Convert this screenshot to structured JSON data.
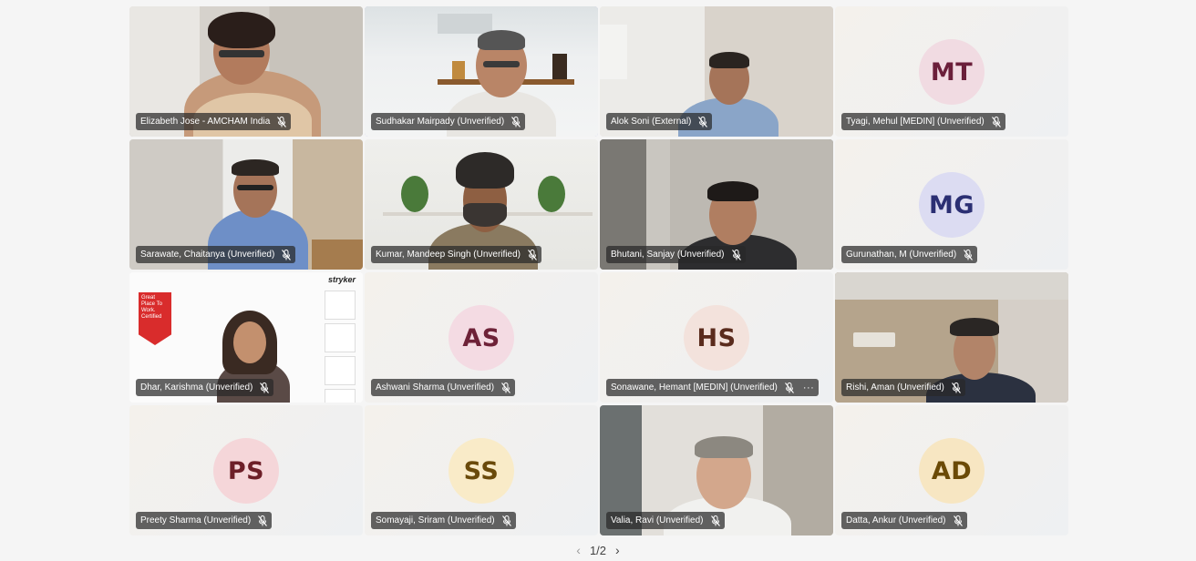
{
  "meeting": {
    "tiles": [
      {
        "name": "Elizabeth Jose - AMCHAM India",
        "type": "video",
        "scene": "office-woman",
        "more": false
      },
      {
        "name": "Sudhakar Mairpady (Unverified)",
        "type": "video",
        "scene": "office-man-shelf",
        "active": true,
        "more": false
      },
      {
        "name": "Alok Soni (External)",
        "type": "video",
        "scene": "room-man",
        "more": false
      },
      {
        "name": "Tyagi, Mehul [MEDIN] (Unverified)",
        "type": "avatar",
        "initials": "MT",
        "avatar_bg": "#f1dbe2",
        "avatar_fg": "#6b1f3a",
        "more": false
      },
      {
        "name": "Sarawate, Chaitanya (Unverified)",
        "type": "video",
        "scene": "office-man-blue",
        "more": false
      },
      {
        "name": "Kumar, Mandeep Singh (Unverified)",
        "type": "video",
        "scene": "turban-man",
        "more": false
      },
      {
        "name": "Bhutani, Sanjay (Unverified)",
        "type": "video",
        "scene": "room-man-dark",
        "more": false
      },
      {
        "name": "Gurunathan, M (Unverified)",
        "type": "avatar",
        "initials": "MG",
        "avatar_bg": "#dcdcf2",
        "avatar_fg": "#2b2f73",
        "more": false
      },
      {
        "name": "Dhar, Karishma (Unverified)",
        "type": "video",
        "scene": "stryker-woman",
        "logo_text": "stryker",
        "badge_text": "Great Place To Work. Certified",
        "more": false
      },
      {
        "name": "Ashwani Sharma (Unverified)",
        "type": "avatar",
        "initials": "AS",
        "avatar_bg": "#f4dbe3",
        "avatar_fg": "#6e2238",
        "more": false
      },
      {
        "name": "Sonawane, Hemant [MEDIN] (Unverified)",
        "type": "avatar",
        "initials": "HS",
        "avatar_bg": "#f3e2dc",
        "avatar_fg": "#5a2b1d",
        "more": true
      },
      {
        "name": "Rishi, Aman (Unverified)",
        "type": "video",
        "scene": "home-man-ac",
        "more": false
      },
      {
        "name": "Preety Sharma (Unverified)",
        "type": "avatar",
        "initials": "PS",
        "avatar_bg": "#f5d6d9",
        "avatar_fg": "#6d1f28",
        "more": false
      },
      {
        "name": "Somayaji, Sriram (Unverified)",
        "type": "avatar",
        "initials": "SS",
        "avatar_bg": "#f9ebc8",
        "avatar_fg": "#6a4a0a",
        "more": false
      },
      {
        "name": "Valia, Ravi (Unverified)",
        "type": "video",
        "scene": "window-man",
        "more": false
      },
      {
        "name": "Datta, Ankur (Unverified)",
        "type": "avatar",
        "initials": "AD",
        "avatar_bg": "#f7e6c2",
        "avatar_fg": "#6b4a06",
        "more": false
      }
    ]
  },
  "pager": {
    "label": "1/2",
    "prev_icon": "chevron-left-icon",
    "next_icon": "chevron-right-icon"
  },
  "icons": {
    "mic": "mic-off-icon",
    "more": "more-options-icon"
  },
  "colors": {
    "active_border": "#6b6fd6",
    "chip_bg": "#282828",
    "page_bg": "#f5f5f5"
  }
}
